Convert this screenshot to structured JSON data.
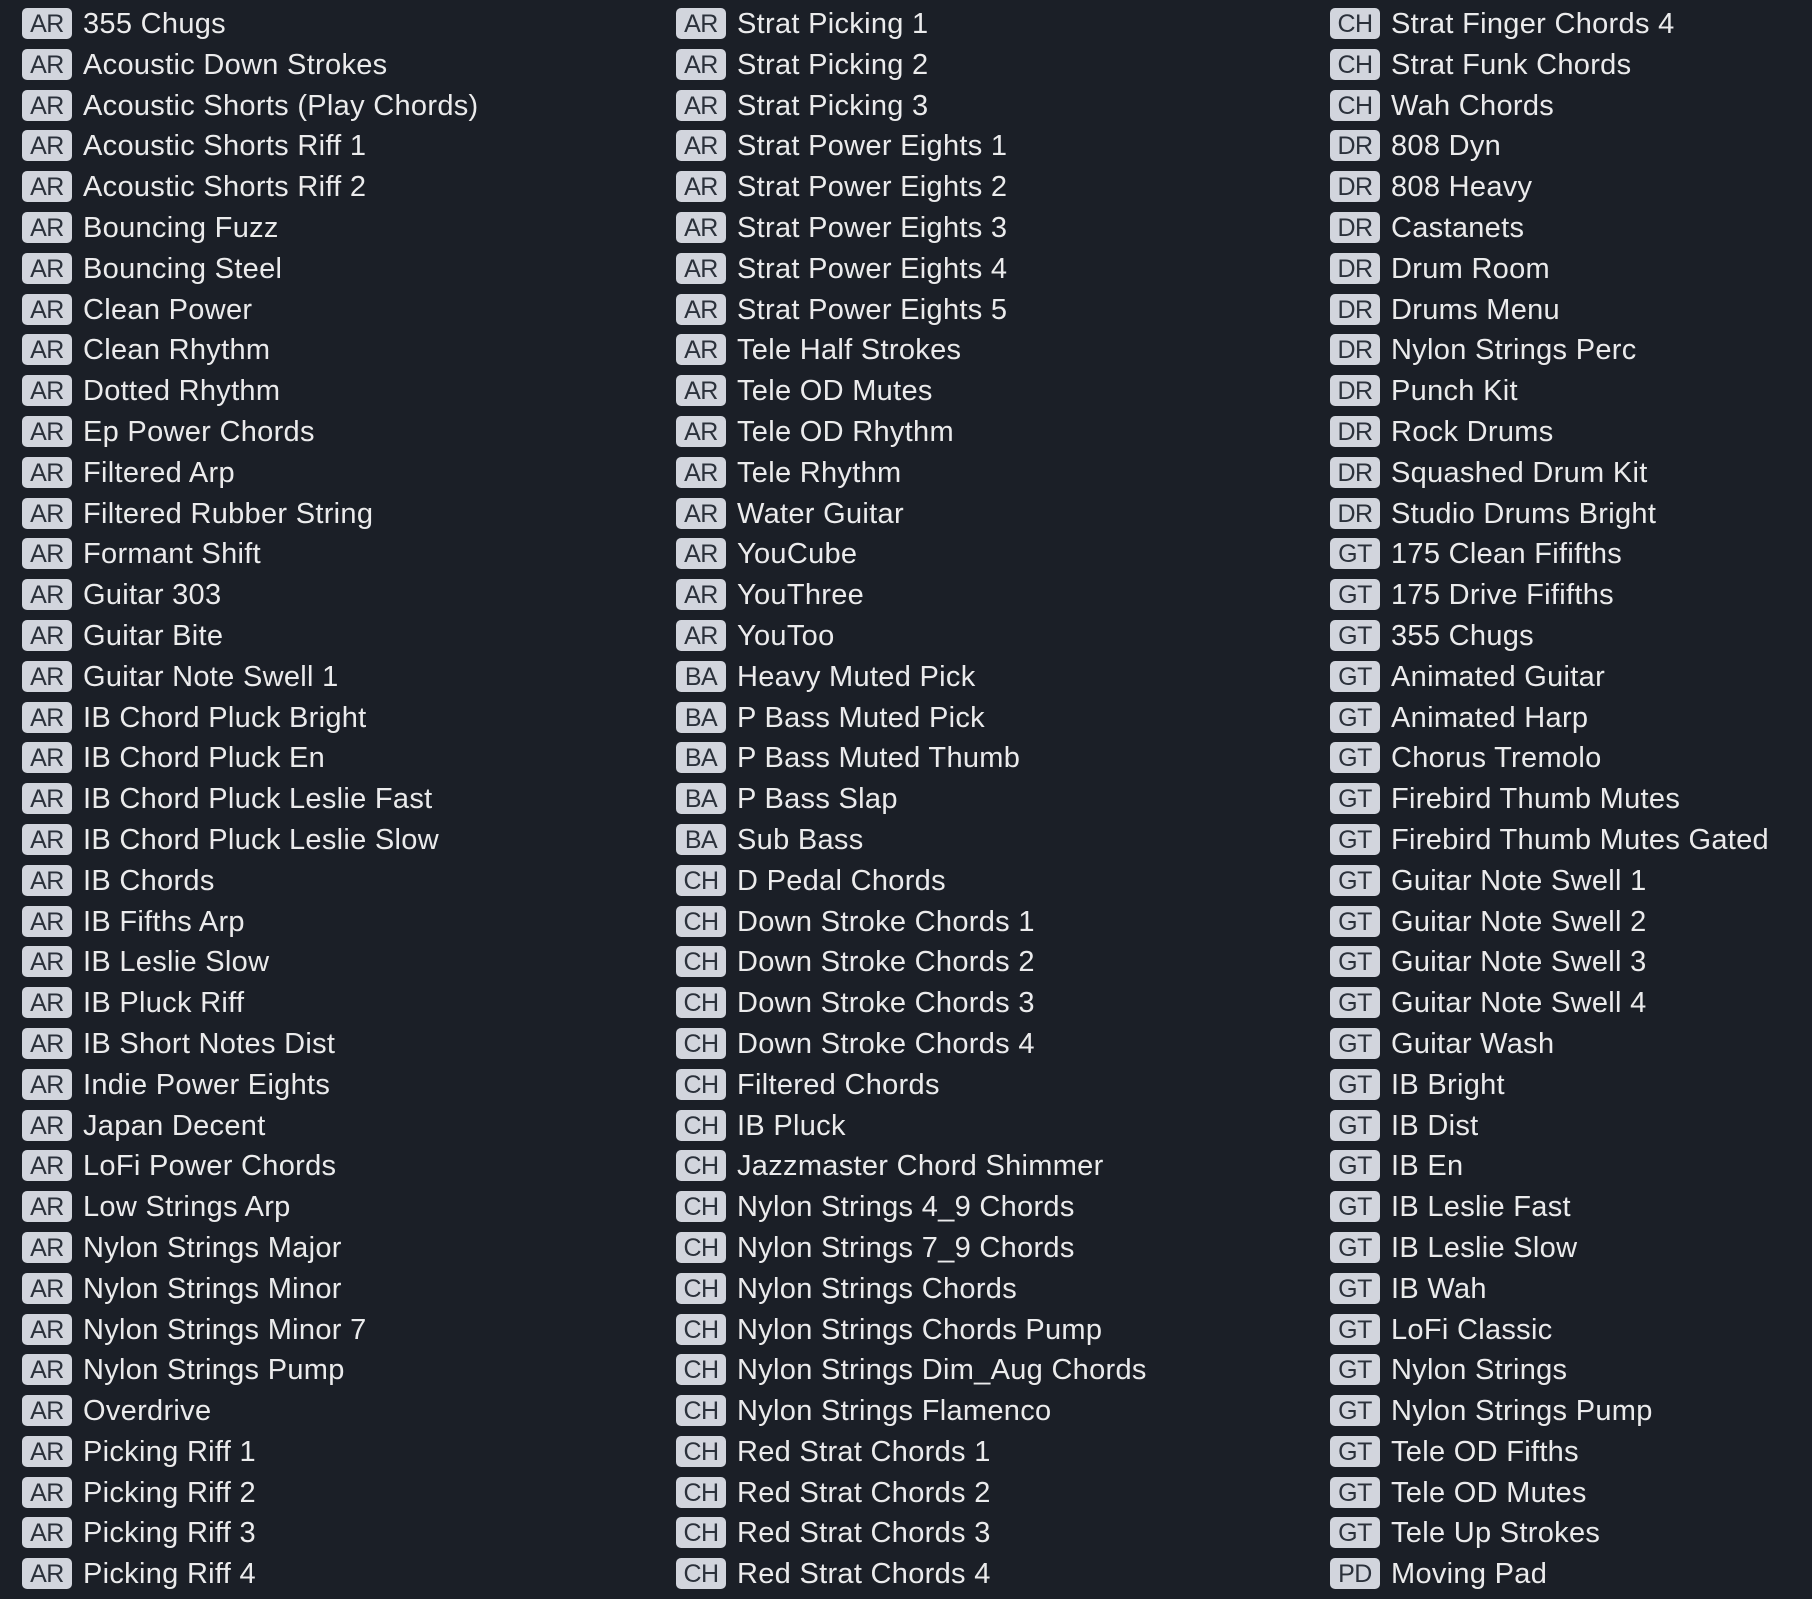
{
  "colors": {
    "background": "#1b1f27",
    "badge_bg": "#d2d5dd",
    "badge_text": "#2b313b",
    "text": "#ebebec"
  },
  "columns": [
    [
      {
        "tag": "AR",
        "label": "355 Chugs"
      },
      {
        "tag": "AR",
        "label": "Acoustic Down Strokes"
      },
      {
        "tag": "AR",
        "label": "Acoustic Shorts (Play Chords)"
      },
      {
        "tag": "AR",
        "label": "Acoustic Shorts Riff 1"
      },
      {
        "tag": "AR",
        "label": "Acoustic Shorts Riff 2"
      },
      {
        "tag": "AR",
        "label": "Bouncing Fuzz"
      },
      {
        "tag": "AR",
        "label": "Bouncing Steel"
      },
      {
        "tag": "AR",
        "label": "Clean Power"
      },
      {
        "tag": "AR",
        "label": "Clean Rhythm"
      },
      {
        "tag": "AR",
        "label": "Dotted Rhythm"
      },
      {
        "tag": "AR",
        "label": "Ep Power Chords"
      },
      {
        "tag": "AR",
        "label": "Filtered Arp"
      },
      {
        "tag": "AR",
        "label": "Filtered Rubber String"
      },
      {
        "tag": "AR",
        "label": "Formant Shift"
      },
      {
        "tag": "AR",
        "label": "Guitar 303"
      },
      {
        "tag": "AR",
        "label": "Guitar Bite"
      },
      {
        "tag": "AR",
        "label": "Guitar Note Swell 1"
      },
      {
        "tag": "AR",
        "label": "IB Chord Pluck Bright"
      },
      {
        "tag": "AR",
        "label": "IB Chord Pluck En"
      },
      {
        "tag": "AR",
        "label": "IB Chord Pluck Leslie Fast"
      },
      {
        "tag": "AR",
        "label": "IB Chord Pluck Leslie Slow"
      },
      {
        "tag": "AR",
        "label": "IB Chords"
      },
      {
        "tag": "AR",
        "label": "IB Fifths Arp"
      },
      {
        "tag": "AR",
        "label": "IB Leslie Slow"
      },
      {
        "tag": "AR",
        "label": "IB Pluck Riff"
      },
      {
        "tag": "AR",
        "label": "IB Short Notes Dist"
      },
      {
        "tag": "AR",
        "label": "Indie Power Eights"
      },
      {
        "tag": "AR",
        "label": "Japan Decent"
      },
      {
        "tag": "AR",
        "label": "LoFi Power Chords"
      },
      {
        "tag": "AR",
        "label": "Low Strings Arp"
      },
      {
        "tag": "AR",
        "label": "Nylon Strings Major"
      },
      {
        "tag": "AR",
        "label": "Nylon Strings Minor"
      },
      {
        "tag": "AR",
        "label": "Nylon Strings Minor 7"
      },
      {
        "tag": "AR",
        "label": "Nylon Strings Pump"
      },
      {
        "tag": "AR",
        "label": "Overdrive"
      },
      {
        "tag": "AR",
        "label": "Picking Riff 1"
      },
      {
        "tag": "AR",
        "label": "Picking Riff 2"
      },
      {
        "tag": "AR",
        "label": "Picking Riff 3"
      },
      {
        "tag": "AR",
        "label": "Picking Riff 4"
      }
    ],
    [
      {
        "tag": "AR",
        "label": "Strat Picking 1"
      },
      {
        "tag": "AR",
        "label": "Strat Picking 2"
      },
      {
        "tag": "AR",
        "label": "Strat Picking 3"
      },
      {
        "tag": "AR",
        "label": "Strat Power Eights 1"
      },
      {
        "tag": "AR",
        "label": "Strat Power Eights 2"
      },
      {
        "tag": "AR",
        "label": "Strat Power Eights 3"
      },
      {
        "tag": "AR",
        "label": "Strat Power Eights 4"
      },
      {
        "tag": "AR",
        "label": "Strat Power Eights 5"
      },
      {
        "tag": "AR",
        "label": "Tele Half Strokes"
      },
      {
        "tag": "AR",
        "label": "Tele OD Mutes"
      },
      {
        "tag": "AR",
        "label": "Tele OD Rhythm"
      },
      {
        "tag": "AR",
        "label": "Tele Rhythm"
      },
      {
        "tag": "AR",
        "label": "Water Guitar"
      },
      {
        "tag": "AR",
        "label": "YouCube"
      },
      {
        "tag": "AR",
        "label": "YouThree"
      },
      {
        "tag": "AR",
        "label": "YouToo"
      },
      {
        "tag": "BA",
        "label": "Heavy Muted Pick"
      },
      {
        "tag": "BA",
        "label": "P Bass Muted Pick"
      },
      {
        "tag": "BA",
        "label": "P Bass Muted Thumb"
      },
      {
        "tag": "BA",
        "label": "P Bass Slap"
      },
      {
        "tag": "BA",
        "label": "Sub Bass"
      },
      {
        "tag": "CH",
        "label": "D Pedal Chords"
      },
      {
        "tag": "CH",
        "label": "Down Stroke Chords 1"
      },
      {
        "tag": "CH",
        "label": "Down Stroke Chords 2"
      },
      {
        "tag": "CH",
        "label": "Down Stroke Chords 3"
      },
      {
        "tag": "CH",
        "label": "Down Stroke Chords 4"
      },
      {
        "tag": "CH",
        "label": "Filtered Chords"
      },
      {
        "tag": "CH",
        "label": "IB Pluck"
      },
      {
        "tag": "CH",
        "label": "Jazzmaster Chord Shimmer"
      },
      {
        "tag": "CH",
        "label": "Nylon Strings 4_9 Chords"
      },
      {
        "tag": "CH",
        "label": "Nylon Strings 7_9 Chords"
      },
      {
        "tag": "CH",
        "label": "Nylon Strings Chords"
      },
      {
        "tag": "CH",
        "label": "Nylon Strings Chords Pump"
      },
      {
        "tag": "CH",
        "label": "Nylon Strings Dim_Aug Chords"
      },
      {
        "tag": "CH",
        "label": "Nylon Strings Flamenco"
      },
      {
        "tag": "CH",
        "label": "Red Strat Chords 1"
      },
      {
        "tag": "CH",
        "label": "Red Strat Chords 2"
      },
      {
        "tag": "CH",
        "label": "Red Strat Chords 3"
      },
      {
        "tag": "CH",
        "label": "Red Strat Chords 4"
      }
    ],
    [
      {
        "tag": "CH",
        "label": "Strat Finger Chords 4"
      },
      {
        "tag": "CH",
        "label": "Strat Funk Chords"
      },
      {
        "tag": "CH",
        "label": "Wah Chords"
      },
      {
        "tag": "DR",
        "label": "808 Dyn"
      },
      {
        "tag": "DR",
        "label": "808 Heavy"
      },
      {
        "tag": "DR",
        "label": "Castanets"
      },
      {
        "tag": "DR",
        "label": "Drum Room"
      },
      {
        "tag": "DR",
        "label": "Drums Menu"
      },
      {
        "tag": "DR",
        "label": "Nylon Strings Perc"
      },
      {
        "tag": "DR",
        "label": "Punch Kit"
      },
      {
        "tag": "DR",
        "label": "Rock Drums"
      },
      {
        "tag": "DR",
        "label": "Squashed Drum Kit"
      },
      {
        "tag": "DR",
        "label": "Studio Drums Bright"
      },
      {
        "tag": "GT",
        "label": "175 Clean Fififths"
      },
      {
        "tag": "GT",
        "label": "175 Drive Fififths"
      },
      {
        "tag": "GT",
        "label": "355 Chugs"
      },
      {
        "tag": "GT",
        "label": "Animated Guitar"
      },
      {
        "tag": "GT",
        "label": "Animated Harp"
      },
      {
        "tag": "GT",
        "label": "Chorus Tremolo"
      },
      {
        "tag": "GT",
        "label": "Firebird Thumb Mutes"
      },
      {
        "tag": "GT",
        "label": "Firebird Thumb Mutes Gated"
      },
      {
        "tag": "GT",
        "label": "Guitar Note Swell 1"
      },
      {
        "tag": "GT",
        "label": "Guitar Note Swell 2"
      },
      {
        "tag": "GT",
        "label": "Guitar Note Swell 3"
      },
      {
        "tag": "GT",
        "label": "Guitar Note Swell 4"
      },
      {
        "tag": "GT",
        "label": "Guitar Wash"
      },
      {
        "tag": "GT",
        "label": "IB Bright"
      },
      {
        "tag": "GT",
        "label": "IB Dist"
      },
      {
        "tag": "GT",
        "label": "IB En"
      },
      {
        "tag": "GT",
        "label": "IB Leslie Fast"
      },
      {
        "tag": "GT",
        "label": "IB Leslie Slow"
      },
      {
        "tag": "GT",
        "label": "IB Wah"
      },
      {
        "tag": "GT",
        "label": "LoFi Classic"
      },
      {
        "tag": "GT",
        "label": "Nylon Strings"
      },
      {
        "tag": "GT",
        "label": "Nylon Strings Pump"
      },
      {
        "tag": "GT",
        "label": "Tele OD Fifths"
      },
      {
        "tag": "GT",
        "label": "Tele OD Mutes"
      },
      {
        "tag": "GT",
        "label": "Tele Up Strokes"
      },
      {
        "tag": "PD",
        "label": "Moving Pad"
      }
    ]
  ]
}
